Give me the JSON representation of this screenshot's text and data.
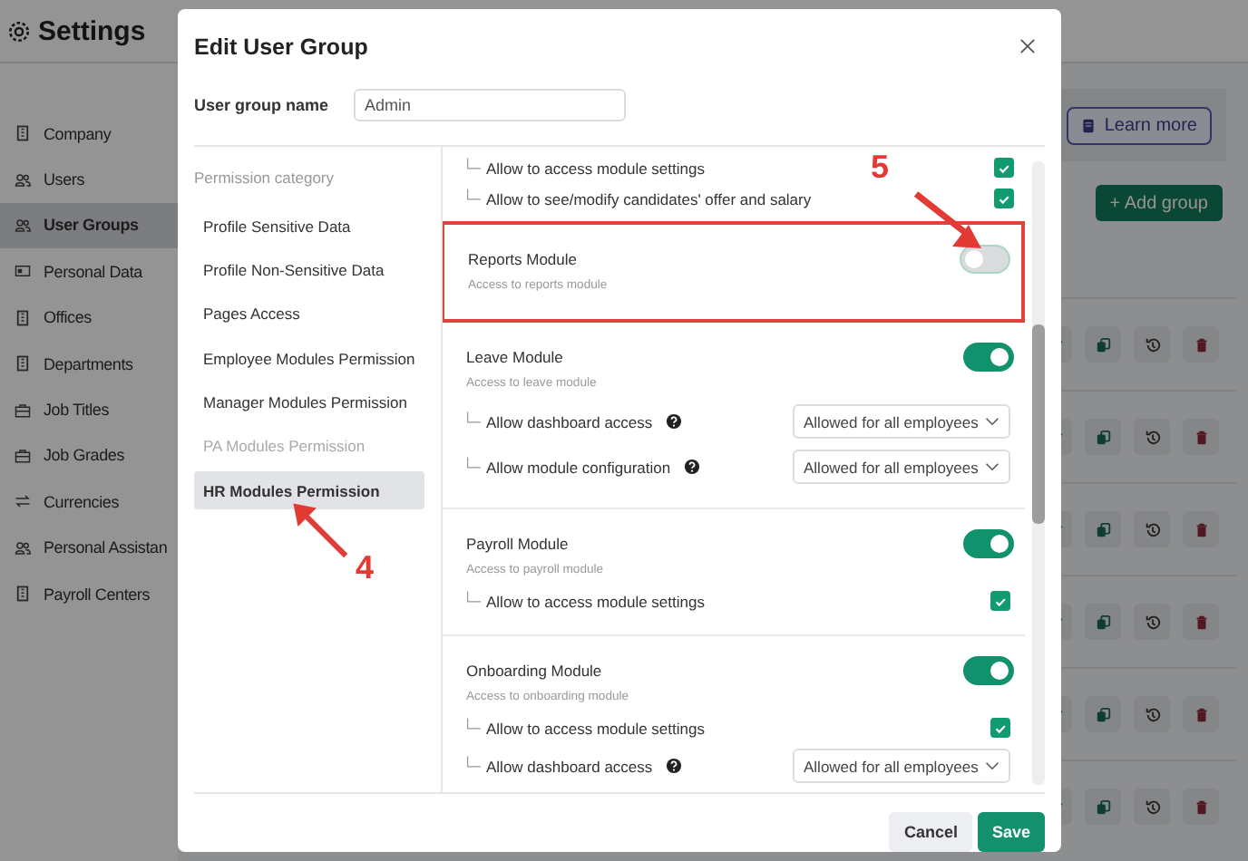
{
  "app": {
    "title": "Settings"
  },
  "sidebar": {
    "items": [
      {
        "label": "Company",
        "selected": false
      },
      {
        "label": "Users",
        "selected": false
      },
      {
        "label": "User Groups",
        "selected": true
      },
      {
        "label": "Personal Data",
        "selected": false
      },
      {
        "label": "Offices",
        "selected": false
      },
      {
        "label": "Departments",
        "selected": false
      },
      {
        "label": "Job Titles",
        "selected": false
      },
      {
        "label": "Job Grades",
        "selected": false
      },
      {
        "label": "Currencies",
        "selected": false
      },
      {
        "label": "Personal Assistan",
        "selected": false
      },
      {
        "label": "Payroll Centers",
        "selected": false
      }
    ]
  },
  "main": {
    "learn_more": "Learn more",
    "add_group": "+ Add group"
  },
  "dialog": {
    "title": "Edit User Group",
    "name_label": "User group name",
    "name_value": "Admin",
    "category_heading": "Permission category",
    "categories": [
      {
        "label": "Profile Sensitive Data",
        "selected": false,
        "disabled": false
      },
      {
        "label": "Profile Non-Sensitive Data",
        "selected": false,
        "disabled": false
      },
      {
        "label": "Pages Access",
        "selected": false,
        "disabled": false
      },
      {
        "label": "Employee Modules Permission",
        "selected": false,
        "disabled": false
      },
      {
        "label": "Manager Modules Permission",
        "selected": false,
        "disabled": false
      },
      {
        "label": "PA Modules Permission",
        "selected": false,
        "disabled": true
      },
      {
        "label": "HR Modules Permission",
        "selected": true,
        "disabled": false
      }
    ],
    "leading_items": [
      {
        "kind": "checkbox",
        "label": "Allow to access module settings",
        "checked": true
      },
      {
        "kind": "checkbox",
        "label": "Allow to see/modify candidates' offer and salary",
        "checked": true
      }
    ],
    "modules": [
      {
        "name": "Reports Module",
        "description": "Access to reports module",
        "on": false,
        "highlighted": true
      },
      {
        "name": "Leave Module",
        "description": "Access to leave module",
        "on": true,
        "highlighted": false,
        "items": [
          {
            "kind": "select",
            "label": "Allow dashboard access",
            "help": true,
            "value": "Allowed for all employees"
          },
          {
            "kind": "select",
            "label": "Allow module configuration",
            "help": true,
            "value": "Allowed for all employees"
          }
        ]
      },
      {
        "name": "Payroll Module",
        "description": "Access to payroll module",
        "on": true,
        "highlighted": false,
        "items": [
          {
            "kind": "checkbox",
            "label": "Allow to access module settings",
            "checked": true
          }
        ]
      },
      {
        "name": "Onboarding Module",
        "description": "Access to onboarding module",
        "on": true,
        "highlighted": false,
        "items": [
          {
            "kind": "checkbox",
            "label": "Allow to access module settings",
            "checked": true
          },
          {
            "kind": "select",
            "label": "Allow dashboard access",
            "help": true,
            "value": "Allowed for all employees"
          }
        ]
      }
    ],
    "buttons": {
      "cancel": "Cancel",
      "save": "Save"
    }
  },
  "annotations": [
    {
      "label": "4"
    },
    {
      "label": "5"
    }
  ]
}
